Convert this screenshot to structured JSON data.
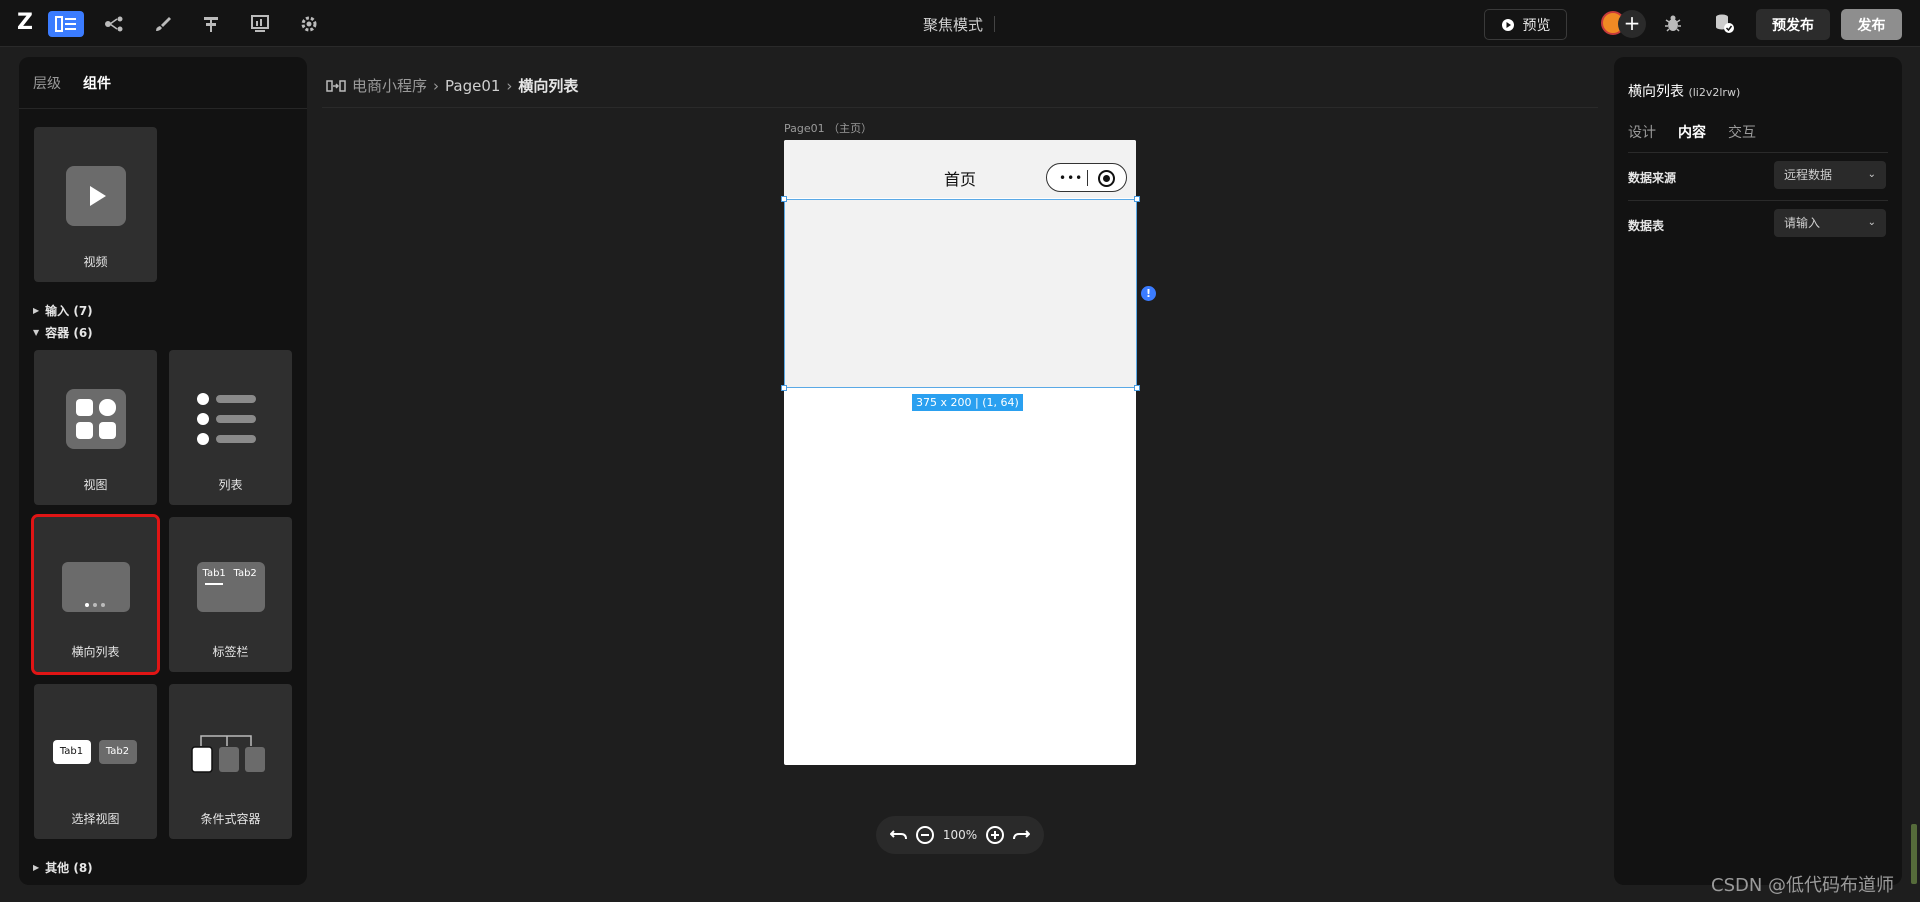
{
  "topbar": {
    "logo": "Z",
    "mode_title": "聚焦模式",
    "preview_label": "预览",
    "add_collab": "+",
    "prepublish_label": "预发布",
    "publish_label": "发布",
    "tools": [
      "layout-icon",
      "flow-icon",
      "brush-icon",
      "align-icon",
      "chart-icon",
      "gear-icon"
    ]
  },
  "left_panel": {
    "tabs": [
      {
        "label": "层级"
      },
      {
        "label": "组件"
      }
    ],
    "top_card": {
      "label": "视频",
      "icon": "play-icon"
    },
    "sections": [
      {
        "label": "输入 (7)",
        "expanded": false
      },
      {
        "label": "容器 (6)",
        "expanded": true
      },
      {
        "label": "其他 (8)",
        "expanded": false
      }
    ],
    "container_cards": [
      {
        "label": "视图",
        "icon": "grid-icon"
      },
      {
        "label": "列表",
        "icon": "list-icon"
      },
      {
        "label": "横向列表",
        "icon": "carousel-icon",
        "selected": true
      },
      {
        "label": "标签栏",
        "icon": "tabbar-icon",
        "tab1": "Tab1",
        "tab2": "Tab2"
      },
      {
        "label": "选择视图",
        "icon": "select-view-icon",
        "tab1": "Tab1",
        "tab2": "Tab2"
      },
      {
        "label": "条件式容器",
        "icon": "conditional-icon"
      }
    ]
  },
  "canvas": {
    "breadcrumb": {
      "root": "电商小程序",
      "page": "Page01",
      "current": "横向列表"
    },
    "page_label": "Page01 （主页）",
    "phone_title": "首页",
    "capsule_dots": "•••",
    "size_tag": "375 x 200 | (1, 64)",
    "warn": "!",
    "zoom": "100%"
  },
  "right_panel": {
    "title": "横向列表",
    "id": "(li2v2lrw)",
    "tabs": [
      {
        "label": "设计"
      },
      {
        "label": "内容",
        "active": true
      },
      {
        "label": "交互"
      }
    ],
    "fields": [
      {
        "label": "数据来源",
        "value": "远程数据"
      },
      {
        "label": "数据表",
        "value": "请输入"
      }
    ]
  },
  "watermark": "CSDN @低代码布道师"
}
